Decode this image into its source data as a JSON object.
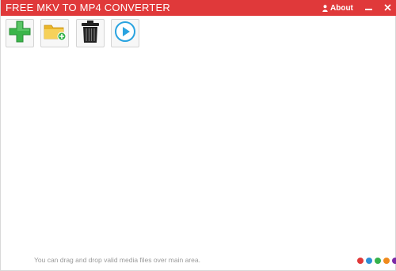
{
  "app": {
    "title": "FREE MKV TO MP4 CONVERTER",
    "titlebar_color": "#e0393a"
  },
  "window_controls": {
    "about_label": "About",
    "about_icon": "user-icon",
    "minimize_icon": "minimize-icon",
    "close_icon": "close-icon"
  },
  "toolbar": {
    "buttons": [
      {
        "id": "add",
        "icon": "plus-icon",
        "color": "#39b54a"
      },
      {
        "id": "add-folder",
        "icon": "folder-add-icon",
        "color": "#f2c233"
      },
      {
        "id": "delete",
        "icon": "trash-icon",
        "color": "#222222"
      },
      {
        "id": "convert",
        "icon": "play-icon",
        "color": "#29a3e0"
      }
    ]
  },
  "status": {
    "hint": "You can drag and drop valid media files over main area."
  },
  "theme_dots": [
    {
      "name": "red",
      "color": "#e0393a"
    },
    {
      "name": "blue",
      "color": "#2d8fd6"
    },
    {
      "name": "green",
      "color": "#35b24b"
    },
    {
      "name": "orange",
      "color": "#f08a1c"
    },
    {
      "name": "purple",
      "color": "#7b2aa6"
    }
  ]
}
